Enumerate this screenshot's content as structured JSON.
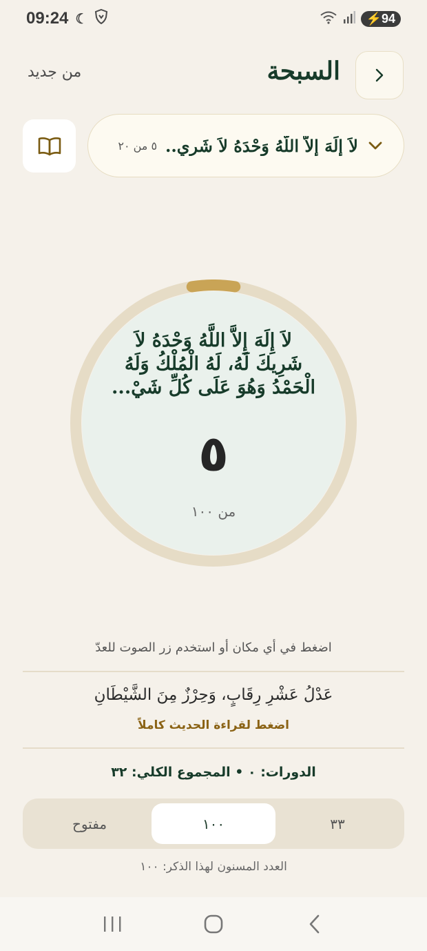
{
  "status_bar": {
    "time": "09:24",
    "battery": "94"
  },
  "header": {
    "title": "السبحة",
    "reset_label": "من جديد"
  },
  "selector": {
    "dhikr_text": "لاَ إِلَهَ إِلاَّ اللَّهُ وَحْدَهُ لاَ شَرِي..",
    "progress_label": "٥ من ٢٠"
  },
  "counter": {
    "dhikr_full": "لاَ إِلَهَ إِلاَّ اللَّهُ وَحْدَهُ لاَ شَرِيكَ لَهُ، لَهُ الْمُلْكُ وَلَهُ الْحَمْدُ وَهُوَ عَلَى كُلِّ شَيْ...",
    "count": "٥",
    "target_label": "من ١٠٠",
    "progress_fraction": 0.05
  },
  "hint": "اضغط في أي مكان أو استخدم زر الصوت للعدّ",
  "virtue": {
    "text": "عَدْلُ عَشْرِ رِقَابٍ، وَحِرْزٌ مِنَ الشَّيْطَانِ",
    "link_label": "اضغط لقراءة الحديث كاملاً"
  },
  "rounds_label": "الدورات: ٠ • المجموع الكلي: ٣٢",
  "targets": {
    "options": [
      "٣٣",
      "١٠٠",
      "مفتوح"
    ],
    "selected_index": 1
  },
  "sunnah_note": "العدد المسنون لهذا الذكر: ١٠٠",
  "colors": {
    "background": "#f5f1ea",
    "primary": "#173b2a",
    "accent": "#c9a456",
    "ring_track": "#e6dcc6",
    "circle_fill": "#eaf1ec"
  }
}
